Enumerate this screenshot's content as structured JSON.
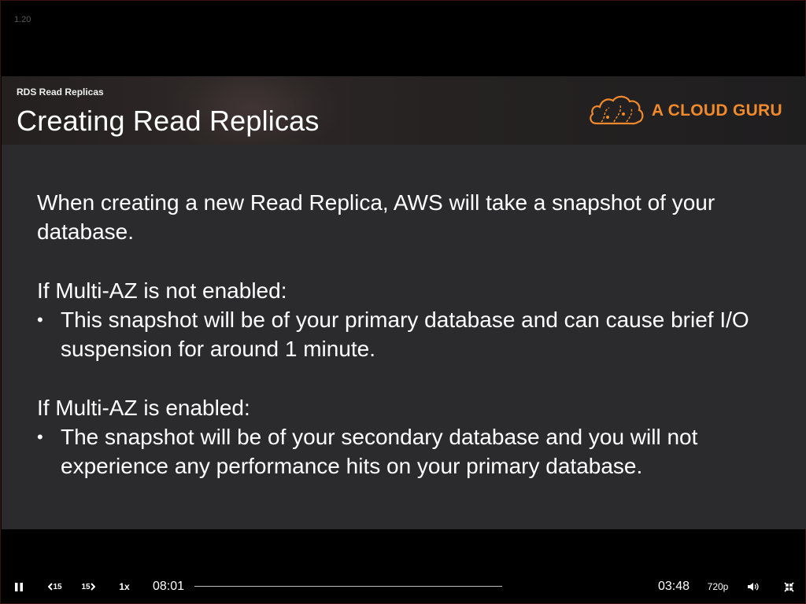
{
  "player": {
    "version": "1.20"
  },
  "slide": {
    "section_label": "RDS Read Replicas",
    "title": "Creating Read Replicas",
    "logo_text": "A CLOUD GURU",
    "intro": "When creating a new Read Replica, AWS will take a snapshot of your database.",
    "blocks": [
      {
        "heading": "If Multi-AZ is not enabled:",
        "bullet": "This snapshot will be of your primary database and can cause brief I/O suspension for around 1 minute."
      },
      {
        "heading": "If Multi-AZ is enabled:",
        "bullet": "The snapshot will be of your secondary database and you will not experience any performance hits on your primary database."
      }
    ],
    "bullet_glyph": "•"
  },
  "controls": {
    "play_pause_icon": "pause-icon",
    "rewind_label": "15",
    "forward_label": "15",
    "playback_rate": "1x",
    "elapsed_time": "08:01",
    "remaining_time": "03:48",
    "quality": "720p",
    "volume_icon": "volume-icon",
    "fullscreen_icon": "exit-fullscreen-icon"
  },
  "colors": {
    "logo_orange": "#f08a2c",
    "slide_background": "#2b2a2c",
    "player_background": "#000000"
  }
}
